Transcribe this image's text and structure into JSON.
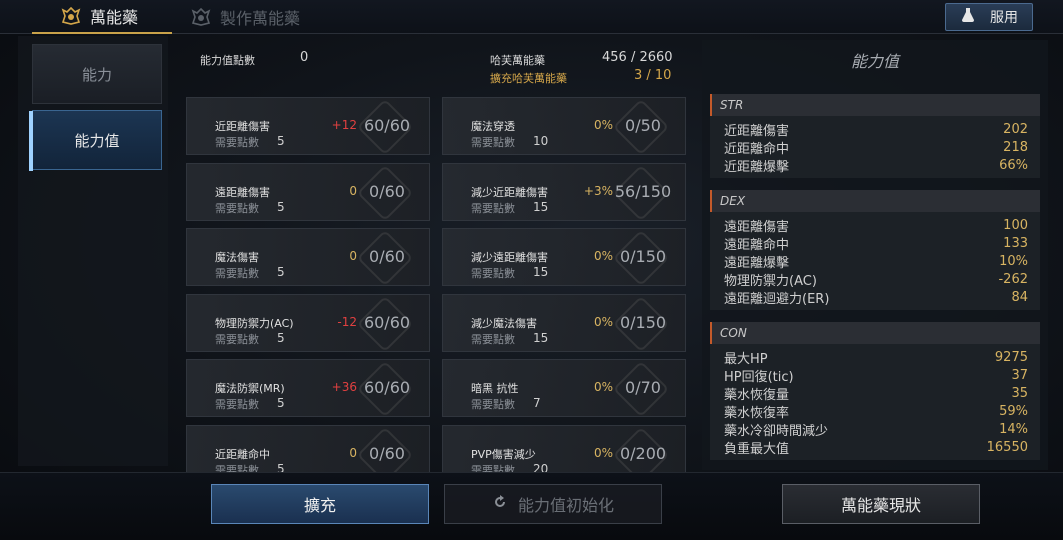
{
  "tabs": [
    {
      "label": "萬能藥",
      "active": true
    },
    {
      "label": "製作萬能藥",
      "active": false
    }
  ],
  "use_button": "服用",
  "nav": [
    "能力",
    "能力值"
  ],
  "header": {
    "points_label": "能力值點數",
    "points_value": "0",
    "elixir_label": "哈芙萬能藥",
    "elixir_value": "456 / 2660",
    "expand_label": "擴充哈芙萬能藥",
    "expand_value": "3 / 10"
  },
  "req_label": "需要點數",
  "cards": [
    {
      "name": "近距離傷害",
      "bonus": "+12",
      "points": "60/60",
      "req": "5",
      "color": "red"
    },
    {
      "name": "魔法穿透",
      "bonus": "0%",
      "points": "0/50",
      "req": "10",
      "color": "gold"
    },
    {
      "name": "遠距離傷害",
      "bonus": "0",
      "points": "0/60",
      "req": "5",
      "color": "gold"
    },
    {
      "name": "減少近距離傷害",
      "bonus": "+3%",
      "points": "56/150",
      "req": "15",
      "color": "gold"
    },
    {
      "name": "魔法傷害",
      "bonus": "0",
      "points": "0/60",
      "req": "5",
      "color": "gold"
    },
    {
      "name": "減少遠距離傷害",
      "bonus": "0%",
      "points": "0/150",
      "req": "15",
      "color": "gold"
    },
    {
      "name": "物理防禦力(AC)",
      "bonus": "-12",
      "points": "60/60",
      "req": "5",
      "color": "red"
    },
    {
      "name": "減少魔法傷害",
      "bonus": "0%",
      "points": "0/150",
      "req": "15",
      "color": "gold"
    },
    {
      "name": "魔法防禦(MR)",
      "bonus": "+36",
      "points": "60/60",
      "req": "5",
      "color": "red"
    },
    {
      "name": "暗黑 抗性",
      "bonus": "0%",
      "points": "0/70",
      "req": "7",
      "color": "gold"
    },
    {
      "name": "近距離命中",
      "bonus": "0",
      "points": "0/60",
      "req": "5",
      "color": "gold"
    },
    {
      "name": "PVP傷害減少",
      "bonus": "0%",
      "points": "0/200",
      "req": "20",
      "color": "gold"
    }
  ],
  "panel": {
    "title": "能力值",
    "sections": [
      {
        "title": "STR",
        "rows": [
          [
            "近距離傷害",
            "202"
          ],
          [
            "近距離命中",
            "218"
          ],
          [
            "近距離爆擊",
            "66%"
          ]
        ]
      },
      {
        "title": "DEX",
        "rows": [
          [
            "遠距離傷害",
            "100"
          ],
          [
            "遠距離命中",
            "133"
          ],
          [
            "遠距離爆擊",
            "10%"
          ],
          [
            "物理防禦力(AC)",
            "-262"
          ],
          [
            "遠距離迴避力(ER)",
            "84"
          ]
        ]
      },
      {
        "title": "CON",
        "rows": [
          [
            "最大HP",
            "9275"
          ],
          [
            "HP回復(tic)",
            "37"
          ],
          [
            "藥水恢復量",
            "35"
          ],
          [
            "藥水恢復率",
            "59%"
          ],
          [
            "藥水冷卻時間減少",
            "14%"
          ],
          [
            "負重最大值",
            "16550"
          ]
        ]
      }
    ]
  },
  "buttons": {
    "expand": "擴充",
    "reset": "能力值初始化",
    "status": "萬能藥現狀"
  },
  "colors": {
    "accent_gold": "#d4a64a",
    "bonus_red": "#e04040",
    "highlight_blue": "#3a6590"
  }
}
